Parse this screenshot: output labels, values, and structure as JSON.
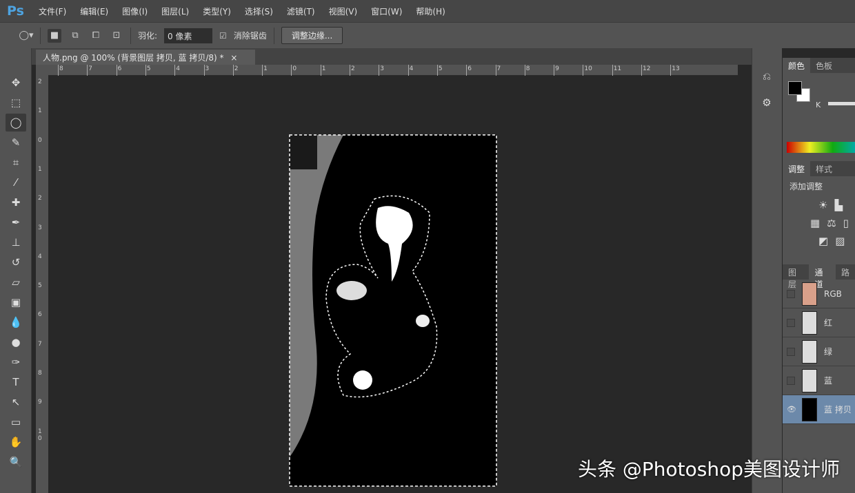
{
  "app": {
    "logo": "Ps"
  },
  "menu": [
    "文件(F)",
    "编辑(E)",
    "图像(I)",
    "图层(L)",
    "类型(Y)",
    "选择(S)",
    "滤镜(T)",
    "视图(V)",
    "窗口(W)",
    "帮助(H)"
  ],
  "options": {
    "feather_label": "羽化:",
    "feather_value": "0 像素",
    "antialias_label": "消除锯齿",
    "antialias_checked": true,
    "refine_edge": "调整边缘..."
  },
  "document": {
    "tab_title": "人物.png @ 100% (背景图层 拷贝, 蓝 拷贝/8) *",
    "close": "×"
  },
  "rulers": {
    "h": [
      "8",
      "7",
      "6",
      "5",
      "4",
      "3",
      "2",
      "1",
      "0",
      "1",
      "2",
      "3",
      "4",
      "5",
      "6",
      "7",
      "8",
      "9",
      "10",
      "11",
      "12",
      "13"
    ],
    "v": [
      "2",
      "1",
      "0",
      "1",
      "2",
      "3",
      "4",
      "5",
      "6",
      "7",
      "8",
      "9",
      "1 0"
    ]
  },
  "color_panel": {
    "tabs": [
      "颜色",
      "色板"
    ],
    "channel": "K",
    "fg": "#000000",
    "bg": "#ffffff"
  },
  "adjust_panel": {
    "tabs": [
      "调整",
      "样式"
    ],
    "title": "添加调整"
  },
  "channels_panel": {
    "tabs": [
      "图层",
      "通道",
      "路"
    ],
    "channels": [
      {
        "name": "RGB",
        "visible": false
      },
      {
        "name": "红",
        "visible": false
      },
      {
        "name": "绿",
        "visible": false
      },
      {
        "name": "蓝",
        "visible": false
      },
      {
        "name": "蓝 拷贝",
        "visible": true,
        "active": true
      }
    ]
  },
  "watermark": "头条 @Photoshop美图设计师"
}
